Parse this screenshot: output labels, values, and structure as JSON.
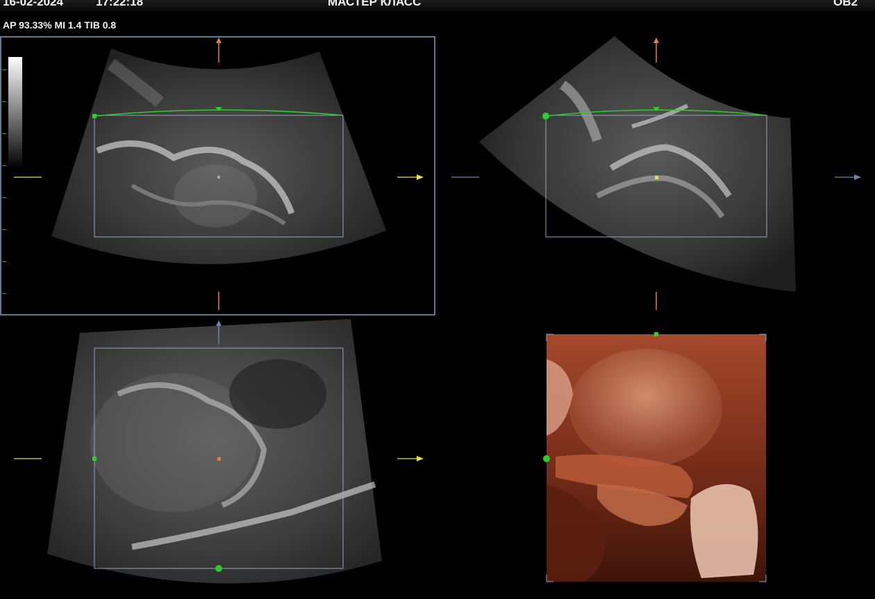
{
  "header": {
    "date": "16-02-2024",
    "time": "17:22:18",
    "title": "МАСТЕР КЛАСС",
    "preset": "OB2"
  },
  "info_line": "AP 93.33%  MI 1.4 TIB 0.8",
  "quadrants": [
    {
      "id": "A",
      "name": "plane-A",
      "active": true
    },
    {
      "id": "B",
      "name": "plane-B",
      "active": false
    },
    {
      "id": "C",
      "name": "plane-C",
      "active": false
    },
    {
      "id": "D",
      "name": "3d-render",
      "active": false
    }
  ],
  "colors": {
    "render_line": "#2ecc2e",
    "roi_box": "#8fa8c0",
    "arrow_up": "#e87a50",
    "arrow_right": "#e8e040",
    "active_border": "#5f7a95",
    "skin_tone": "#8a3a24"
  },
  "icons": [
    "orange-up-arrow-icon",
    "yellow-right-arrow-icon",
    "blue-up-arrow-icon",
    "blue-right-arrow-icon",
    "green-dot-icon"
  ]
}
